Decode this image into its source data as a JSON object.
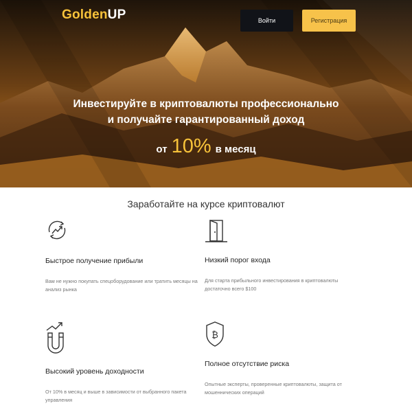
{
  "header": {
    "logo_gold": "Golden",
    "logo_white": "UP",
    "login_label": "Войти",
    "register_label": "Регистрация"
  },
  "hero": {
    "line1": "Инвестируйте в криптовалюты профессионально",
    "line2": "и получайте гарантированный доход",
    "prefix": "от",
    "rate": "10%",
    "suffix": "в месяц"
  },
  "section": {
    "title": "Заработайте на курсе криптовалют"
  },
  "features": [
    {
      "icon": "refresh-growth-icon",
      "title": "Быстрое получение прибыли",
      "desc": "Вам не нужно покупать спецоборудование или тратить месяцы на анализ рынка"
    },
    {
      "icon": "door-icon",
      "title": "Низкий порог входа",
      "desc": "Для старта прибыльного инвестирования в криптовалюты достаточно всего $100"
    },
    {
      "icon": "magnet-growth-icon",
      "title": "Высокий уровень доходности",
      "desc": "От 10% в месяц и выше в зависимости от выбранного пакета управления"
    },
    {
      "icon": "bitcoin-shield-icon",
      "title": "Полное отсутствие риска",
      "desc": "Опытные эксперты, проверенные криптовалюты, защита от мошеннических операций"
    }
  ],
  "colors": {
    "accent": "#f7c23a",
    "button_dark": "#111318",
    "button_gold": "#f7c24a"
  }
}
